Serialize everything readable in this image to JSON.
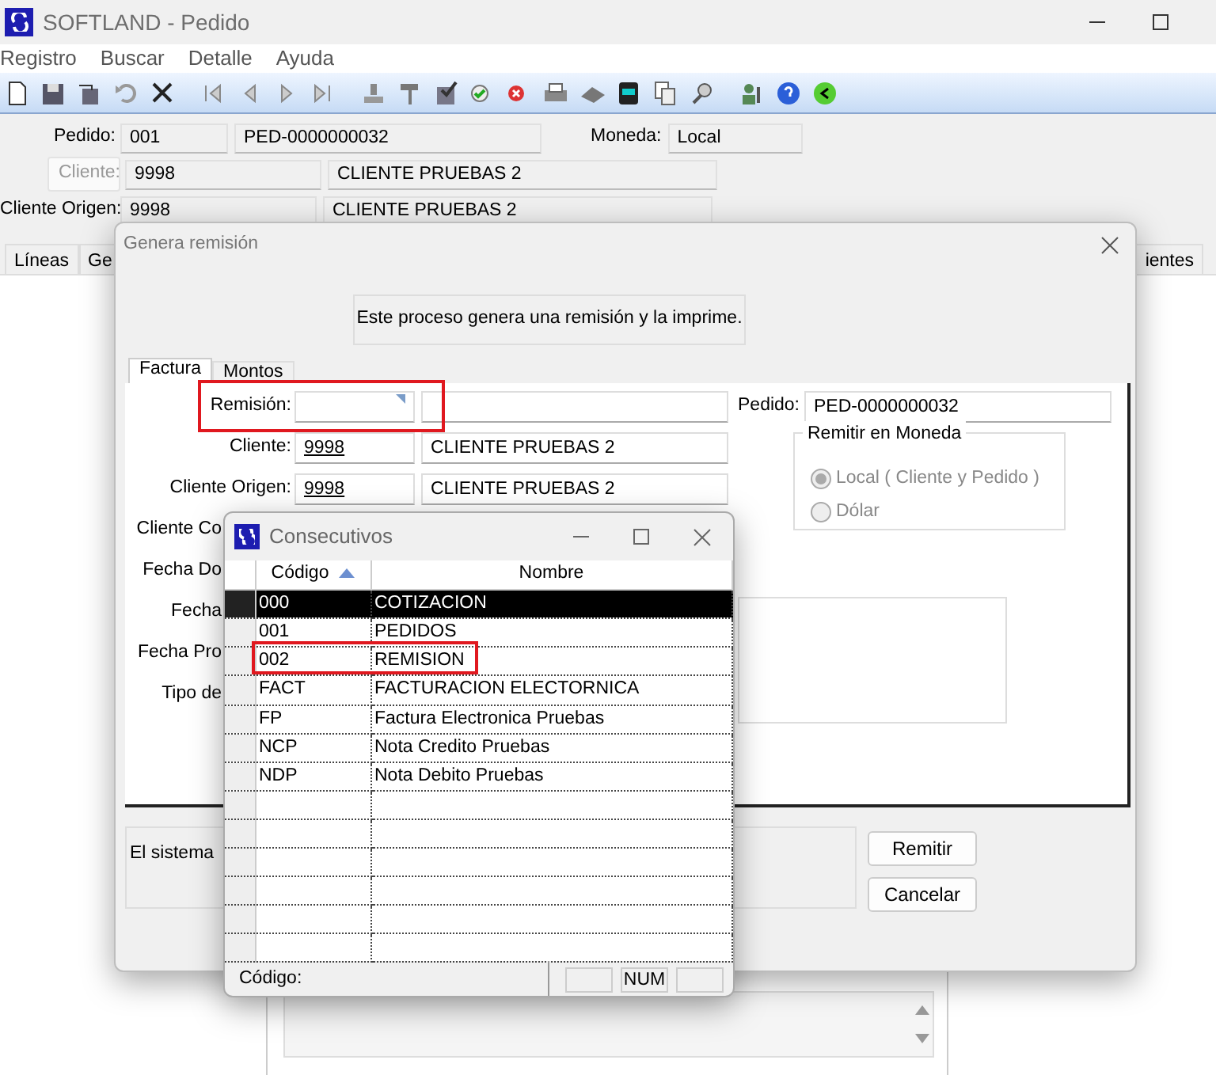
{
  "window": {
    "title": "SOFTLAND - Pedido"
  },
  "menu": [
    "Registro",
    "Buscar",
    "Detalle",
    "Ayuda"
  ],
  "header_rows": [
    {
      "label": "Pedido:",
      "kind": "text",
      "code": "001",
      "name": "PED-0000000032",
      "extra_label": "Moneda:",
      "extra_value": "Local"
    },
    {
      "label": "Cliente:",
      "kind": "button",
      "code": "9998",
      "name": "CLIENTE PRUEBAS 2"
    },
    {
      "label": "Cliente Origen:",
      "kind": "text",
      "code": "9998",
      "name": "CLIENTE PRUEBAS 2"
    }
  ],
  "main_tabs": [
    {
      "label": "Líneas",
      "selected": false
    },
    {
      "label": "Ge",
      "selected": false
    },
    {
      "label": "ientes",
      "selected": false
    }
  ],
  "dialog": {
    "title": "Genera remisión",
    "info": "Este proceso genera una remisión y la imprime.",
    "tabs": [
      {
        "label": "Factura",
        "selected": true
      },
      {
        "label": "Montos",
        "selected": false
      }
    ],
    "rows": [
      {
        "kind": "lookup",
        "label": "Remisión:",
        "highlighted": true
      },
      {
        "kind": "lookup",
        "label": "Cliente:",
        "code": "9998",
        "name": "CLIENTE PRUEBAS 2",
        "highlighted": false
      },
      {
        "kind": "lookup",
        "label": "Cliente Origen:",
        "code": "9998",
        "name": "CLIENTE PRUEBAS 2",
        "highlighted": false
      },
      {
        "kind": "covered",
        "label": "Cliente Co"
      },
      {
        "kind": "covered",
        "label": "Fecha Do"
      },
      {
        "kind": "covered",
        "label": "Fecha"
      },
      {
        "kind": "covered",
        "label": "Fecha Pro"
      },
      {
        "kind": "covered",
        "label": "Tipo de"
      }
    ],
    "pedido": {
      "label": "Pedido:",
      "value": "PED-0000000032"
    },
    "currency_group": {
      "title": "Remitir en Moneda",
      "disabled": true,
      "options": [
        {
          "label": "Local ( Cliente y Pedido )",
          "selected": true
        },
        {
          "label": "Dólar",
          "selected": false
        }
      ]
    },
    "message": "El sistema",
    "buttons": [
      "Remitir",
      "Cancelar"
    ]
  },
  "lookup": {
    "title": "Consecutivos",
    "columns": [
      {
        "label": "Código",
        "sort_ascending": true
      },
      {
        "label": "Nombre",
        "sort_ascending": false
      }
    ],
    "rows": [
      {
        "code": "000",
        "name": "COTIZACION",
        "selected": true,
        "highlighted": false
      },
      {
        "code": "001",
        "name": "PEDIDOS",
        "selected": false,
        "highlighted": false
      },
      {
        "code": "002",
        "name": "REMISION",
        "selected": false,
        "highlighted": true
      },
      {
        "code": "FACT",
        "name": "FACTURACION ELECTORNICA",
        "selected": false,
        "highlighted": false
      },
      {
        "code": "FP",
        "name": "Factura Electronica Pruebas",
        "selected": false,
        "highlighted": false
      },
      {
        "code": "NCP",
        "name": "Nota Credito Pruebas",
        "selected": false,
        "highlighted": false
      },
      {
        "code": "NDP",
        "name": "Nota Debito Pruebas",
        "selected": false,
        "highlighted": false
      }
    ],
    "status": {
      "label": "Código:",
      "indicator": "NUM"
    }
  }
}
